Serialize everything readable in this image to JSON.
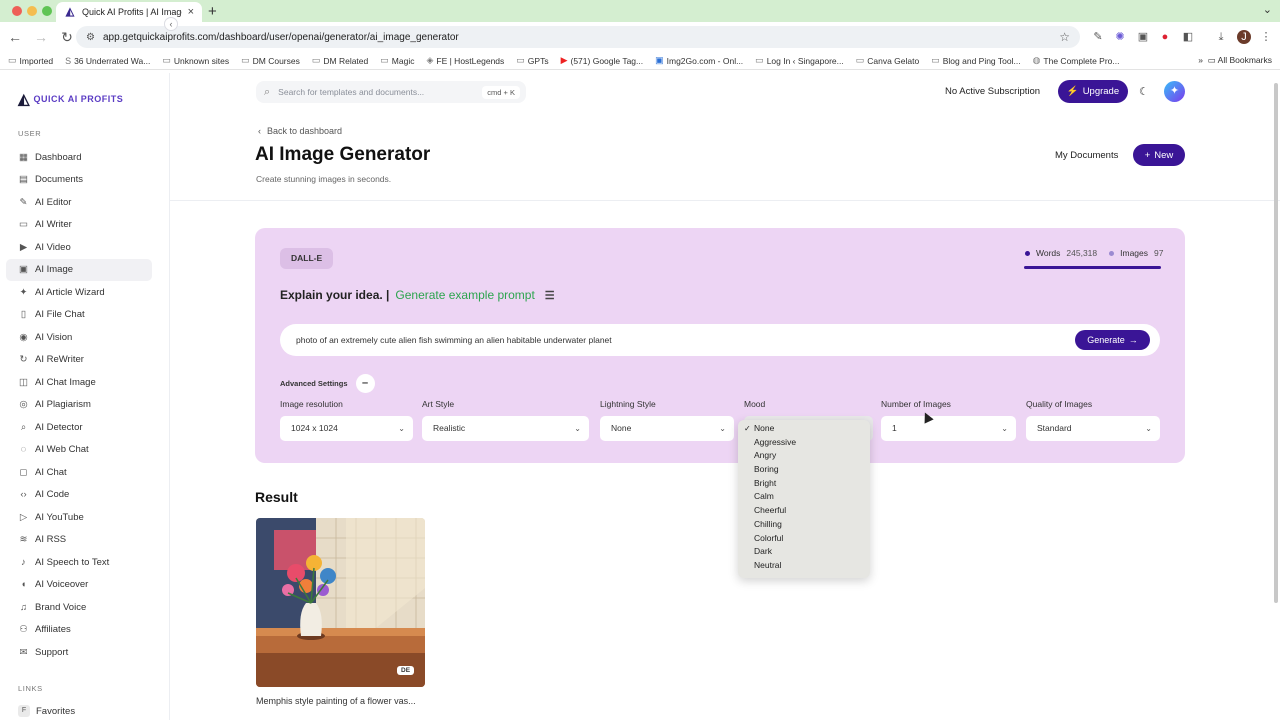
{
  "browser": {
    "tab_title": "Quick AI Profits | AI Image Ge",
    "url": "app.getquickaiprofits.com/dashboard/user/openai/generator/ai_image_generator",
    "bookmarks": [
      "Imported",
      "36 Underrated Wa...",
      "Unknown sites",
      "DM Courses",
      "DM Related",
      "Magic",
      "FE | HostLegends",
      "GPTs",
      "(571) Google Tag...",
      "Img2Go.com - Onl...",
      "Log In ‹ Singapore...",
      "Canva Gelato",
      "Blog and Ping Tool...",
      "The Complete Pro..."
    ],
    "all_bookmarks": "All Bookmarks"
  },
  "sidebar": {
    "logo_text": "QUICK AI PROFITS",
    "section_user": "USER",
    "items": [
      {
        "label": "Dashboard",
        "icon": "▦"
      },
      {
        "label": "Documents",
        "icon": "▤"
      },
      {
        "label": "AI Editor",
        "icon": "✎"
      },
      {
        "label": "AI Writer",
        "icon": "▭"
      },
      {
        "label": "AI Video",
        "icon": "▶"
      },
      {
        "label": "AI Image",
        "icon": "▣"
      },
      {
        "label": "AI Article Wizard",
        "icon": "✦"
      },
      {
        "label": "AI File Chat",
        "icon": "▯"
      },
      {
        "label": "AI Vision",
        "icon": "◉"
      },
      {
        "label": "AI ReWriter",
        "icon": "↻"
      },
      {
        "label": "AI Chat Image",
        "icon": "◫"
      },
      {
        "label": "AI Plagiarism",
        "icon": "◎"
      },
      {
        "label": "AI Detector",
        "icon": "⌕"
      },
      {
        "label": "AI Web Chat",
        "icon": "◌"
      },
      {
        "label": "AI Chat",
        "icon": "◻"
      },
      {
        "label": "AI Code",
        "icon": "‹›"
      },
      {
        "label": "AI YouTube",
        "icon": "▷"
      },
      {
        "label": "AI RSS",
        "icon": "≋"
      },
      {
        "label": "AI Speech to Text",
        "icon": "♪"
      },
      {
        "label": "AI Voiceover",
        "icon": "◖"
      },
      {
        "label": "Brand Voice",
        "icon": "♫"
      },
      {
        "label": "Affiliates",
        "icon": "⚇"
      },
      {
        "label": "Support",
        "icon": "✉"
      }
    ],
    "active_index": 5,
    "section_links": "LINKS",
    "favorites": "Favorites"
  },
  "topbar": {
    "search_placeholder": "Search for templates and documents...",
    "search_shortcut": "cmd + K",
    "subscription": "No Active Subscription",
    "upgrade": "Upgrade"
  },
  "header": {
    "back": "Back to dashboard",
    "title": "AI Image Generator",
    "subtitle": "Create stunning images in seconds.",
    "my_documents": "My Documents",
    "new": "New"
  },
  "generator": {
    "engine": "DALL-E",
    "words_label": "Words",
    "words_value": "245,318",
    "images_label": "Images",
    "images_value": "97",
    "explain_label": "Explain your idea. |",
    "example_prompt": "Generate example prompt",
    "prompt_value": "photo of an extremely cute alien fish swimming an alien habitable underwater planet",
    "generate": "Generate",
    "advanced": "Advanced Settings",
    "fields": {
      "resolution": {
        "label": "Image resolution",
        "value": "1024 x 1024"
      },
      "art_style": {
        "label": "Art Style",
        "value": "Realistic"
      },
      "lightning": {
        "label": "Lightning Style",
        "value": "None"
      },
      "mood": {
        "label": "Mood",
        "value": "None"
      },
      "num_images": {
        "label": "Number of Images",
        "value": "1"
      },
      "quality": {
        "label": "Quality of Images",
        "value": "Standard"
      }
    },
    "mood_options": [
      "None",
      "Aggressive",
      "Angry",
      "Boring",
      "Bright",
      "Calm",
      "Cheerful",
      "Chilling",
      "Colorful",
      "Dark",
      "Neutral"
    ]
  },
  "result": {
    "title": "Result",
    "badge": "DE",
    "caption": "Memphis style painting of a flower vas..."
  }
}
